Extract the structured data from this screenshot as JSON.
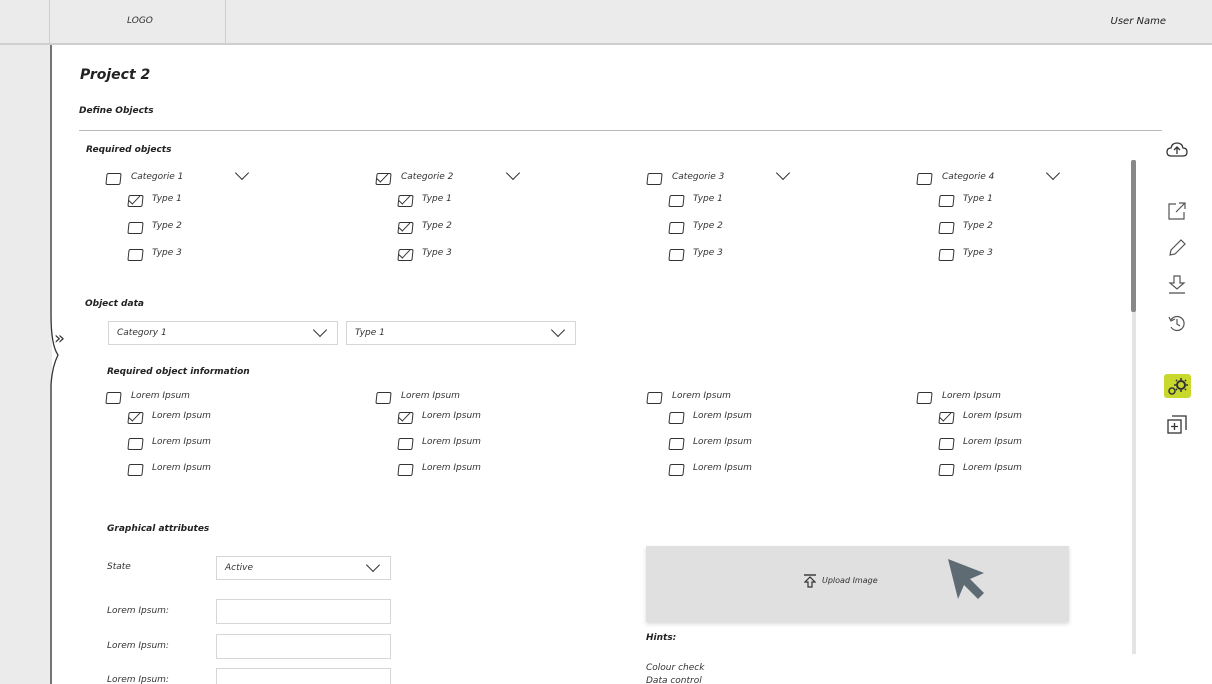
{
  "header": {
    "logo": "LOGO",
    "user_name": "User Name"
  },
  "page": {
    "title": "Project 2",
    "subtitle": "Define Objects"
  },
  "required_objects": {
    "heading": "Required objects",
    "categories": [
      {
        "label": "Categorie 1",
        "checked": false,
        "types": [
          {
            "label": "Type 1",
            "checked": true
          },
          {
            "label": "Type 2",
            "checked": false
          },
          {
            "label": "Type 3",
            "checked": false
          }
        ]
      },
      {
        "label": "Categorie 2",
        "checked": true,
        "types": [
          {
            "label": "Type 1",
            "checked": true
          },
          {
            "label": "Type 2",
            "checked": true
          },
          {
            "label": "Type 3",
            "checked": true
          }
        ]
      },
      {
        "label": "Categorie 3",
        "checked": false,
        "types": [
          {
            "label": "Type 1",
            "checked": false
          },
          {
            "label": "Type 2",
            "checked": false
          },
          {
            "label": "Type 3",
            "checked": false
          }
        ]
      },
      {
        "label": "Categorie 4",
        "checked": false,
        "types": [
          {
            "label": "Type 1",
            "checked": false
          },
          {
            "label": "Type 2",
            "checked": false
          },
          {
            "label": "Type 3",
            "checked": false
          }
        ]
      }
    ]
  },
  "object_data": {
    "heading": "Object data",
    "category_select": "Category 1",
    "type_select": "Type 1",
    "info_heading": "Required object information",
    "columns": [
      {
        "label": "Lorem Ipsum",
        "checked": false,
        "items": [
          {
            "label": "Lorem Ipsum",
            "checked": true
          },
          {
            "label": "Lorem Ipsum",
            "checked": false
          },
          {
            "label": "Lorem Ipsum",
            "checked": false
          }
        ]
      },
      {
        "label": "Lorem Ipsum",
        "checked": false,
        "items": [
          {
            "label": "Lorem Ipsum",
            "checked": true
          },
          {
            "label": "Lorem Ipsum",
            "checked": false
          },
          {
            "label": "Lorem Ipsum",
            "checked": false
          }
        ]
      },
      {
        "label": "Lorem Ipsum",
        "checked": false,
        "items": [
          {
            "label": "Lorem Ipsum",
            "checked": false
          },
          {
            "label": "Lorem Ipsum",
            "checked": false
          },
          {
            "label": "Lorem Ipsum",
            "checked": false
          }
        ]
      },
      {
        "label": "Lorem Ipsum",
        "checked": false,
        "items": [
          {
            "label": "Lorem Ipsum",
            "checked": true
          },
          {
            "label": "Lorem Ipsum",
            "checked": false
          },
          {
            "label": "Lorem Ipsum",
            "checked": false
          }
        ]
      }
    ]
  },
  "graphical": {
    "heading": "Graphical attributes",
    "state_label": "State",
    "state_value": "Active",
    "fields": [
      {
        "label": "Lorem Ipsum:",
        "value": ""
      },
      {
        "label": "Lorem Ipsum:",
        "value": ""
      },
      {
        "label": "Lorem Ipsum:",
        "value": ""
      }
    ],
    "upload_label": "Upload Image",
    "hints_heading": "Hints:",
    "hints": [
      "Colour check",
      "Data control"
    ]
  },
  "toolbar_icons": [
    "cloud-upload-icon",
    "external-link-icon",
    "pencil-icon",
    "download-icon",
    "history-icon",
    "settings-gear-icon",
    "add-box-icon"
  ],
  "colors": {
    "accent": "#c9d82d",
    "chrome": "#ebebeb"
  }
}
